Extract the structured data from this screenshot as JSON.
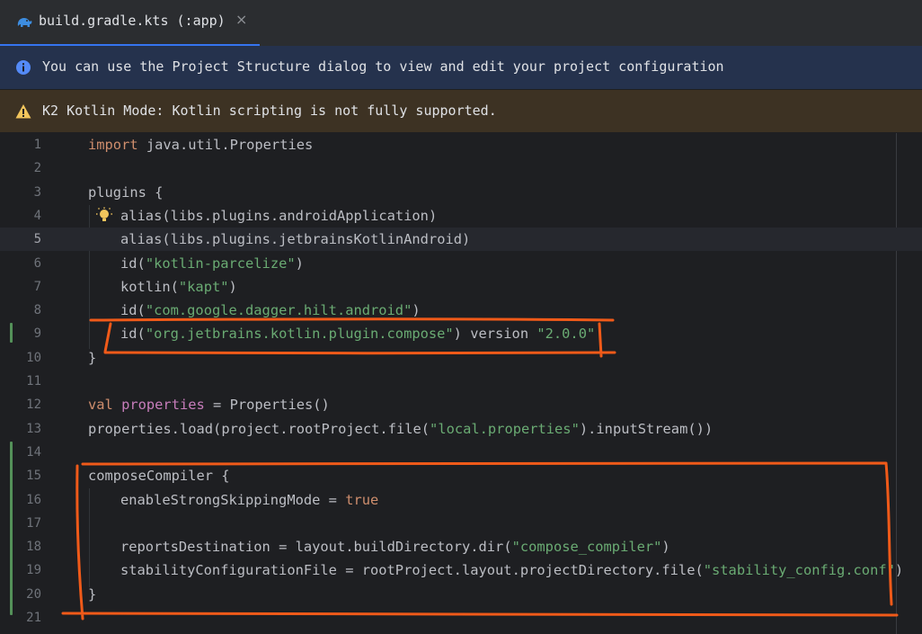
{
  "tab": {
    "label": "build.gradle.kts (:app)",
    "close": "×",
    "icon": "gradle-elephant-icon"
  },
  "info_banner": {
    "text": "You can use the Project Structure dialog to view and edit your project configuration",
    "icon": "info-icon"
  },
  "warning_banner": {
    "text": "K2 Kotlin Mode: Kotlin scripting is not fully supported.",
    "icon": "warning-icon"
  },
  "editor": {
    "current_line": 5,
    "lines": [
      {
        "n": "1"
      },
      {
        "n": "2"
      },
      {
        "n": "3"
      },
      {
        "n": "4"
      },
      {
        "n": "5"
      },
      {
        "n": "6"
      },
      {
        "n": "7"
      },
      {
        "n": "8"
      },
      {
        "n": "9"
      },
      {
        "n": "10"
      },
      {
        "n": "11"
      },
      {
        "n": "12"
      },
      {
        "n": "13"
      },
      {
        "n": "14"
      },
      {
        "n": "15"
      },
      {
        "n": "16"
      },
      {
        "n": "17"
      },
      {
        "n": "18"
      },
      {
        "n": "19"
      },
      {
        "n": "20"
      },
      {
        "n": "21"
      }
    ],
    "code": {
      "l1": [
        "import",
        " java",
        ".",
        "util",
        ".",
        "Properties"
      ],
      "l3": [
        "plugins",
        " {"
      ],
      "l4": [
        "alias",
        "(",
        "libs",
        ".",
        "plugins",
        ".",
        "androidApplication",
        ")"
      ],
      "l5": [
        "alias",
        "(",
        "libs",
        ".",
        "plugins",
        ".",
        "jetbrainsKotlinAndroid",
        ")"
      ],
      "l6": [
        "id",
        "(",
        "\"kotlin-parcelize\"",
        ")"
      ],
      "l7": [
        "kotlin",
        "(",
        "\"kapt\"",
        ")"
      ],
      "l8": [
        "id",
        "(",
        "\"com.google.dagger.hilt.android\"",
        ")"
      ],
      "l9": [
        "id",
        "(",
        "\"org.jetbrains.kotlin.plugin.compose\"",
        ")",
        " version ",
        "\"2.0.0\""
      ],
      "l10": [
        "}"
      ],
      "l12": [
        "val",
        " ",
        "properties",
        " = ",
        "Properties",
        "()"
      ],
      "l13": [
        "properties",
        ".",
        "load",
        "(",
        "project",
        ".",
        "rootProject",
        ".",
        "file",
        "(",
        "\"local.properties\"",
        ")",
        ".",
        "inputStream",
        "())"
      ],
      "l15": [
        "composeCompiler",
        " {"
      ],
      "l16": [
        "enableStrongSkippingMode",
        " = ",
        "true"
      ],
      "l18": [
        "reportsDestination",
        " = ",
        "layout",
        ".",
        "buildDirectory",
        ".",
        "dir",
        "(",
        "\"compose_compiler\"",
        ")"
      ],
      "l19": [
        "stabilityConfigurationFile",
        " = ",
        "rootProject",
        ".",
        "layout",
        ".",
        "projectDirectory",
        ".",
        "file",
        "(",
        "\"stability_config.conf\"",
        ")"
      ],
      "l20": [
        "}"
      ]
    }
  },
  "colors": {
    "keyword": "#cf8e6d",
    "string": "#6aab73",
    "property": "#c77dbb",
    "text": "#bcbec4",
    "annotation": "#f05a19",
    "vcs_added": "#549159"
  },
  "icons": {
    "intention": "lightbulb-icon"
  }
}
